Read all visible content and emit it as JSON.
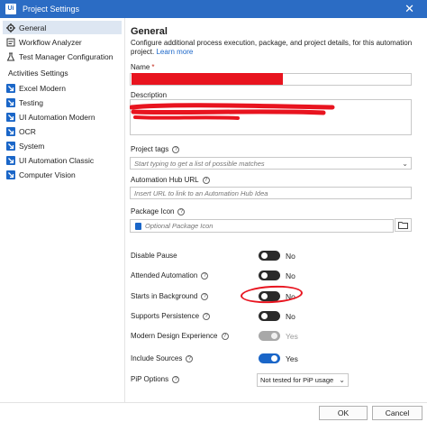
{
  "window": {
    "app_badge": "Ui",
    "title": "Project Settings",
    "close_glyph": "✕"
  },
  "sidebar": {
    "items": [
      {
        "label": "General",
        "icon": "gear-icon",
        "active": true
      },
      {
        "label": "Workflow Analyzer",
        "icon": "workflow-analyzer-icon"
      },
      {
        "label": "Test Manager Configuration",
        "icon": "test-manager-icon"
      }
    ],
    "section_label": "Activities Settings",
    "activity_items": [
      {
        "label": "Excel Modern",
        "icon": "activity-icon"
      },
      {
        "label": "Testing",
        "icon": "activity-icon"
      },
      {
        "label": "UI Automation Modern",
        "icon": "activity-icon"
      },
      {
        "label": "OCR",
        "icon": "activity-icon"
      },
      {
        "label": "System",
        "icon": "activity-icon"
      },
      {
        "label": "UI Automation Classic",
        "icon": "activity-icon"
      },
      {
        "label": "Computer Vision",
        "icon": "activity-icon"
      }
    ],
    "accent_color": "#1a66c8"
  },
  "main": {
    "heading": "General",
    "description": "Configure additional process execution, package, and project details, for this automation project.",
    "learn_more": "Learn more",
    "name_label": "Name",
    "name_required_mark": "*",
    "description_label": "Description",
    "project_tags_label": "Project tags",
    "project_tags_placeholder": "Start typing to get a list of possible matches",
    "hub_url_label": "Automation Hub URL",
    "hub_url_placeholder": "Insert URL to link to an Automation Hub Idea",
    "package_icon_label": "Package Icon",
    "package_icon_placeholder": "Optional Package Icon",
    "toggles": [
      {
        "label": "Disable Pause",
        "value": "No",
        "state": "off"
      },
      {
        "label": "Attended Automation",
        "value": "No",
        "state": "off"
      },
      {
        "label": "Starts in Background",
        "value": "No",
        "state": "off"
      },
      {
        "label": "Supports Persistence",
        "value": "No",
        "state": "off"
      },
      {
        "label": "Modern Design Experience",
        "value": "Yes",
        "state": "disabled"
      },
      {
        "label": "Include Sources",
        "value": "Yes",
        "state": "on"
      }
    ],
    "pip_label": "PiP Options",
    "pip_selected": "Not tested for PiP usage"
  },
  "footer": {
    "ok_label": "OK",
    "cancel_label": "Cancel"
  },
  "colors": {
    "titlebar": "#2b6cc4",
    "toggle_on": "#1a66c8",
    "annotation_red": "#e8141f"
  }
}
